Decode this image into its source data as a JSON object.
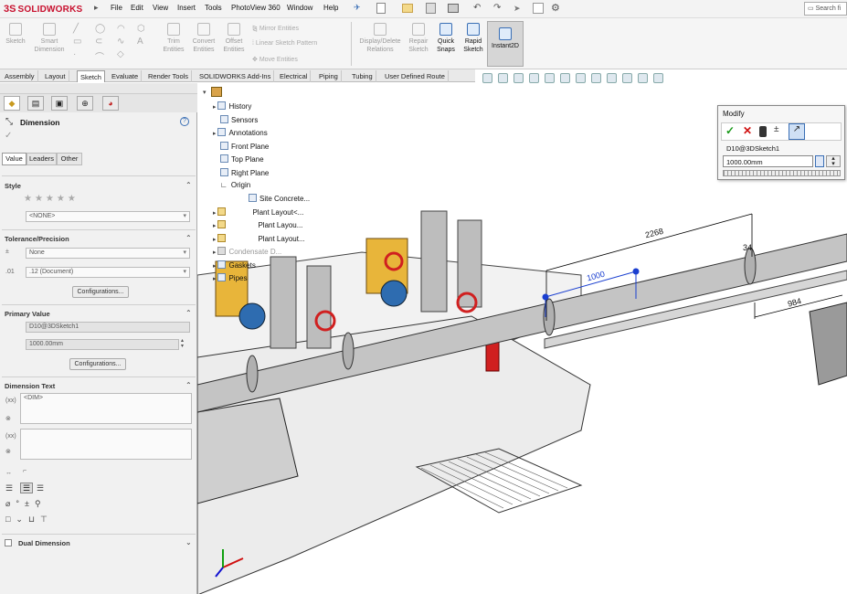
{
  "app": {
    "logo_ds": "3S",
    "logo_text": "SOLIDWORKS",
    "brand_color": "#c8102e"
  },
  "menu": [
    "File",
    "Edit",
    "View",
    "Insert",
    "Tools",
    "PhotoView 360",
    "Window",
    "Help"
  ],
  "search_placeholder": "Search fi",
  "toolbar": {
    "sketch": "Sketch",
    "smart_dimension": "Smart Dimension",
    "trim_entities": "Trim Entities",
    "convert_entities": "Convert Entities",
    "offset_entities": "Offset Entities",
    "mirror_entities": "Mirror Entities",
    "linear_sketch_pattern": "Linear Sketch Pattern",
    "move_entities": "Move Entities",
    "display_delete_relations": "Display/Delete Relations",
    "repair_sketch": "Repair Sketch",
    "quick_snaps": "Quick Snaps",
    "rapid_sketch": "Rapid Sketch",
    "instant2d": "Instant2D"
  },
  "tabs": [
    "Assembly",
    "Layout",
    "Sketch",
    "Evaluate",
    "Render Tools",
    "SOLIDWORKS Add-Ins",
    "Electrical",
    "Piping",
    "Tubing",
    "User Defined Route"
  ],
  "active_tab": "Sketch",
  "property_manager": {
    "title": "Dimension",
    "subtabs": [
      "Value",
      "Leaders",
      "Other"
    ],
    "style_label": "Style",
    "style_value": "<NONE>",
    "tolerance_label": "Tolerance/Precision",
    "tolerance_value": "None",
    "precision_value": ".12 (Document)",
    "configurations_label": "Configurations...",
    "primary_value_label": "Primary Value",
    "primary_name": "D10@3DSketch1",
    "primary_value": "1000.00mm",
    "dimension_text_label": "Dimension Text",
    "dimension_text_value": "<DIM>",
    "dual_dimension_label": "Dual Dimension"
  },
  "feature_tree": [
    "History",
    "Sensors",
    "Annotations",
    "Front Plane",
    "Top Plane",
    "Right Plane",
    "Origin",
    "Site Concrete...",
    "Plant Layout<...",
    "Plant Layou...",
    "Plant Layout...",
    "Condensate D...",
    "Gaskets",
    "Pipes"
  ],
  "modify": {
    "title": "Modify",
    "name": "D10@3DSketch1",
    "value": "1000.00mm"
  },
  "dimensions": {
    "d1": "2268",
    "d2": "1000",
    "d3": "984",
    "d4": "34"
  }
}
